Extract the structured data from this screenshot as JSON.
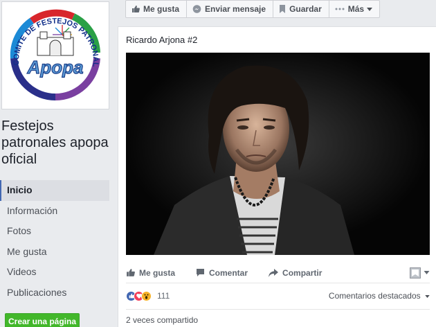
{
  "page": {
    "name": "Festejos patronales apopa oficial",
    "logo_text_arc": "COMITE DE FESTEJOS PATRONALES",
    "logo_text_main": "Apopa"
  },
  "sidebar": {
    "items": [
      {
        "label": "Inicio",
        "active": true
      },
      {
        "label": "Información"
      },
      {
        "label": "Fotos"
      },
      {
        "label": "Me gusta"
      },
      {
        "label": "Videos"
      },
      {
        "label": "Publicaciones"
      }
    ],
    "create_button": "Crear una página"
  },
  "actionbar": {
    "like": {
      "label": "Me gusta",
      "icon": "thumbs-up-icon"
    },
    "message": {
      "label": "Enviar mensaje",
      "icon": "messenger-icon"
    },
    "save": {
      "label": "Guardar",
      "icon": "bookmark-icon"
    },
    "more": {
      "label": "Más",
      "icon": "ellipsis-icon"
    }
  },
  "post": {
    "text": "Ricardo Arjona #2",
    "actions": {
      "like": "Me gusta",
      "comment": "Comentar",
      "share": "Compartir"
    },
    "reactions": {
      "types": [
        "like",
        "love",
        "wow"
      ],
      "count": "111"
    },
    "comments_sort": "Comentarios destacados",
    "shared": "2 veces compartido"
  },
  "colors": {
    "facebook_blue": "#4267b2",
    "green": "#42b72a",
    "love": "#f33e58",
    "wow": "#f7b125"
  }
}
